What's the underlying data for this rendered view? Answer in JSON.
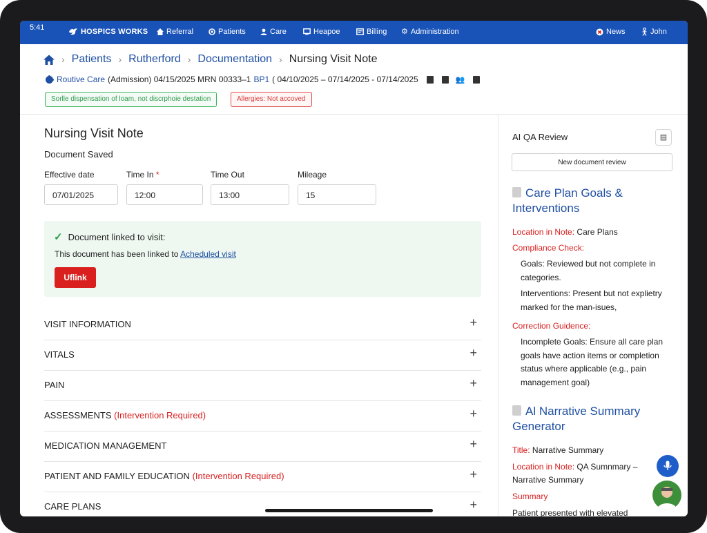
{
  "status_bar": {
    "time": "5:41"
  },
  "nav": {
    "brand": "HOSPICS WORKS",
    "items": [
      {
        "label": "Referral",
        "icon": "home-icon"
      },
      {
        "label": "Patients",
        "icon": "circle-icon"
      },
      {
        "label": "Care",
        "icon": "user-icon"
      },
      {
        "label": "Heapoe",
        "icon": "monitor-icon"
      },
      {
        "label": "Billing",
        "icon": "card-icon"
      },
      {
        "label": "Administration",
        "icon": "gear-icon"
      }
    ],
    "news_label": "News",
    "user_label": "John"
  },
  "breadcrumb": {
    "items": [
      "Patients",
      "Rutherford",
      "Documentation"
    ],
    "current": "Nursing Visit Note"
  },
  "patient": {
    "care_type": "Routive Care",
    "admission": "(Admission) 04/15/2025 MRN 00333–1",
    "bp": "BP1",
    "period": "( 04/10/2025 – 07/14/2025 - 07/14/2025"
  },
  "badges": {
    "green": "Sorlle dispensation of loam, not discrphoie destation",
    "red": "Allergies: Not accoved"
  },
  "form": {
    "title": "Nursing Visit Note",
    "status": "Document Saved",
    "fields": {
      "effective_date": {
        "label": "Effective date",
        "value": "07/01/2025"
      },
      "time_in": {
        "label": "Time In",
        "required_mark": "*",
        "value": "12:00"
      },
      "time_out": {
        "label": "Time Out",
        "value": "13:00"
      },
      "mileage": {
        "label": "Mileage",
        "value": "15"
      }
    },
    "linked": {
      "title": "Document linked to visit:",
      "text_prefix": "This document has been linked to ",
      "link_text": "Acheduled visit",
      "button": "Uflink"
    },
    "sections": [
      {
        "label": "VISIT INFORMATION",
        "warning": ""
      },
      {
        "label": "VITALS",
        "warning": ""
      },
      {
        "label": "PAIN",
        "warning": ""
      },
      {
        "label": "ASSESSMENTS",
        "warning": "(Intervention Required)"
      },
      {
        "label": "MEDICATION MANAGEMENT",
        "warning": ""
      },
      {
        "label": "PATIENT AND FAMILY EDUCATION",
        "warning": "(Intervention Required)"
      },
      {
        "label": "CARE PLANS",
        "warning": ""
      }
    ]
  },
  "review_panel": {
    "title": "AI QA Review",
    "new_review_button": "New document review",
    "care_plan": {
      "heading": "Care Plan Goals & Interventions",
      "location_label": "Location in Note:",
      "location_value": "Care Plans",
      "compliance_label": "Compliance Check:",
      "goals_text": "Goals: Reviewed but not complete in categories.",
      "interventions_text": "Interventions: Present but not explietry marked for the man-isues,",
      "guidance_label": "Correction Guidence:",
      "guidance_text": "Incomplete Goals: Ensure all care plan goals have action items or completion status where applicable (e.g., pain management goal)"
    },
    "narrative": {
      "heading": "Al Narrative Summary Generator",
      "title_label": "Title:",
      "title_value": "Narrative Summary",
      "location_label": "Location in Note:",
      "location_value": "QA Sumnmary –",
      "location_value_2": "Narrative Summary",
      "summary_label": "Summary",
      "summary_text": "Patient presented with elevated"
    }
  }
}
